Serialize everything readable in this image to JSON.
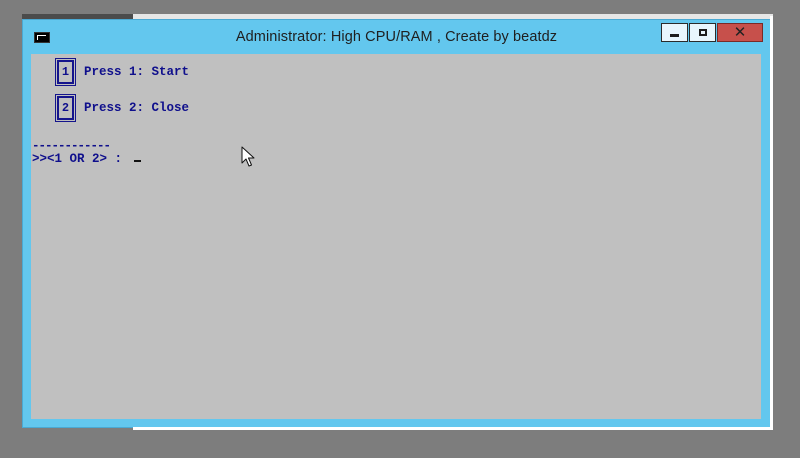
{
  "window": {
    "title": "Administrator:  High CPU/RAM , Create by beatdz",
    "controls": {
      "minimize_icon": "minimize-icon",
      "maximize_icon": "maximize-icon",
      "close_glyph": "✕"
    }
  },
  "console": {
    "options": [
      {
        "key": "1",
        "label": "Press 1: Start"
      },
      {
        "key": "2",
        "label": "Press 2: Close"
      }
    ],
    "divider": "------------",
    "prompt": ">><1 OR 2> : "
  },
  "colors": {
    "frame": "#63c7ee",
    "console_bg": "#c0c0c0",
    "console_text": "#0f0f8c",
    "close_button": "#c7504b"
  }
}
